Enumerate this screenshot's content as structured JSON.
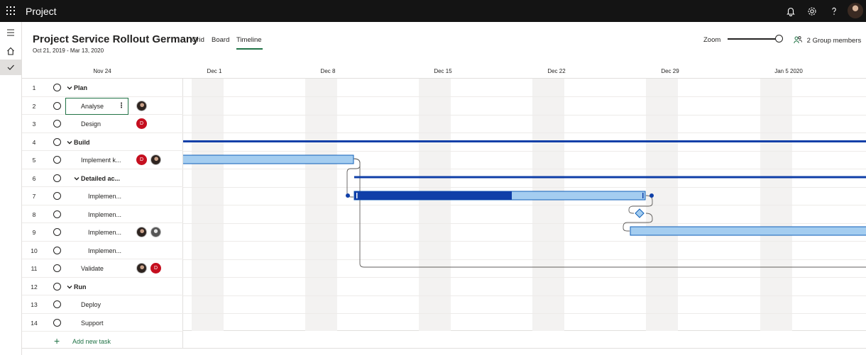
{
  "topbar": {
    "app_name": "Project"
  },
  "header": {
    "title": "Project Service Rollout Germany",
    "dates": "Oct 21, 2019 - Mar 13, 2020",
    "tabs": [
      {
        "label": "Grid"
      },
      {
        "label": "Board"
      },
      {
        "label": "Timeline",
        "active": true
      }
    ],
    "zoom_label": "Zoom",
    "zoom_level": 0.9,
    "members_label": "2 Group members"
  },
  "axis": {
    "labels": [
      "Nov 24",
      "Dec 1",
      "Dec 8",
      "Dec 15",
      "Dec 22",
      "Dec 29",
      "Jan 5 2020"
    ]
  },
  "tasks": [
    {
      "num": "1",
      "name": "Plan",
      "summary": true
    },
    {
      "num": "2",
      "name": "Analyse",
      "editing": true,
      "assignees": [
        "photo"
      ]
    },
    {
      "num": "3",
      "name": "Design",
      "assignees": [
        "D"
      ]
    },
    {
      "num": "4",
      "name": "Build",
      "summary": true
    },
    {
      "num": "5",
      "name": "Implement k...",
      "assignees": [
        "D",
        "photo"
      ]
    },
    {
      "num": "6",
      "name": "Detailed ac...",
      "summary": true
    },
    {
      "num": "7",
      "name": "Implemen..."
    },
    {
      "num": "8",
      "name": "Implemen..."
    },
    {
      "num": "9",
      "name": "Implemen...",
      "assignees": [
        "photo",
        "photo2"
      ]
    },
    {
      "num": "10",
      "name": "Implemen..."
    },
    {
      "num": "11",
      "name": "Validate",
      "assignees": [
        "photo",
        "D"
      ]
    },
    {
      "num": "12",
      "name": "Run",
      "summary": true
    },
    {
      "num": "13",
      "name": "Deploy"
    },
    {
      "num": "14",
      "name": "Support"
    }
  ],
  "add_task_label": "Add new task",
  "colors": {
    "accent": "#217346",
    "bar_light": "#a4cdf0",
    "bar_dark": "#0f3fa8",
    "summary_line": "#0f3fa8",
    "avatar_red": "#c50f1f"
  },
  "icons": {
    "waffle": "app-launcher-icon",
    "bell": "bell-icon",
    "gear": "gear-icon",
    "help": "help-icon",
    "menu": "hamburger-icon",
    "home": "home-icon",
    "check": "check-icon"
  }
}
